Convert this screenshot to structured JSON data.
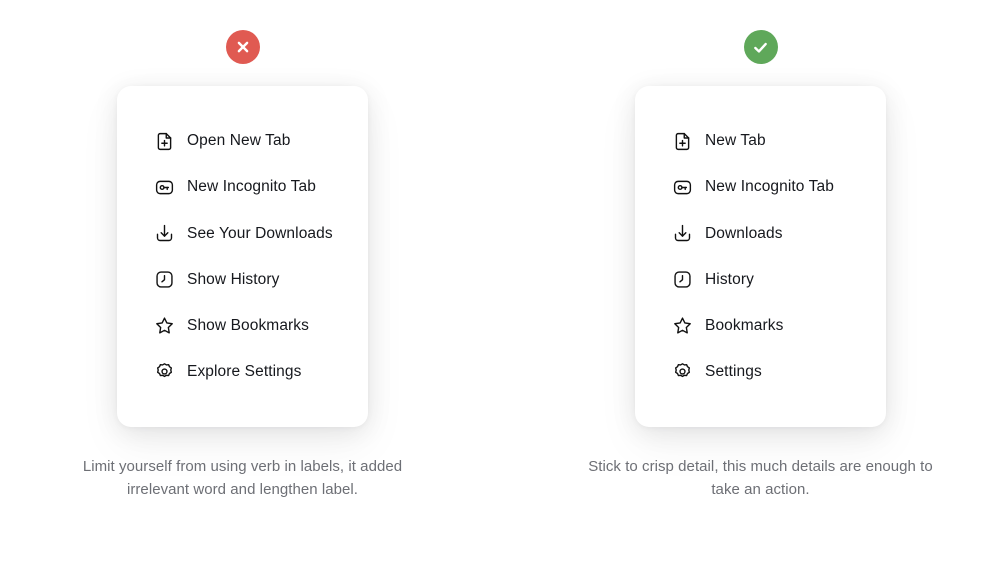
{
  "colors": {
    "background": "#ffffff",
    "card_background": "#ffffff",
    "bad_badge": "#e05a52",
    "good_badge": "#5fa85a",
    "label_text": "#16181d",
    "caption_text": "#6d6f75",
    "icon_stroke": "#111111"
  },
  "columns": [
    {
      "id": "dont",
      "badge": {
        "icon": "cross-icon",
        "color": "#e05a52",
        "meaning": "incorrect"
      },
      "menu": {
        "items": [
          {
            "icon": "file-plus-icon",
            "label": "Open New Tab"
          },
          {
            "icon": "incognito-key-icon",
            "label": "New Incognito Tab"
          },
          {
            "icon": "download-icon",
            "label": "See Your Downloads"
          },
          {
            "icon": "clock-history-icon",
            "label": "Show History"
          },
          {
            "icon": "star-icon",
            "label": "Show Bookmarks"
          },
          {
            "icon": "gear-icon",
            "label": "Explore Settings"
          }
        ]
      },
      "caption": "Limit yourself from using verb in labels, it added irrelevant word and lengthen label."
    },
    {
      "id": "do",
      "badge": {
        "icon": "check-icon",
        "color": "#5fa85a",
        "meaning": "correct"
      },
      "menu": {
        "items": [
          {
            "icon": "file-plus-icon",
            "label": "New Tab"
          },
          {
            "icon": "incognito-key-icon",
            "label": "New Incognito Tab"
          },
          {
            "icon": "download-icon",
            "label": "Downloads"
          },
          {
            "icon": "clock-history-icon",
            "label": "History"
          },
          {
            "icon": "star-icon",
            "label": "Bookmarks"
          },
          {
            "icon": "gear-icon",
            "label": "Settings"
          }
        ]
      },
      "caption": "Stick to crisp detail, this much details are enough to take an action."
    }
  ]
}
